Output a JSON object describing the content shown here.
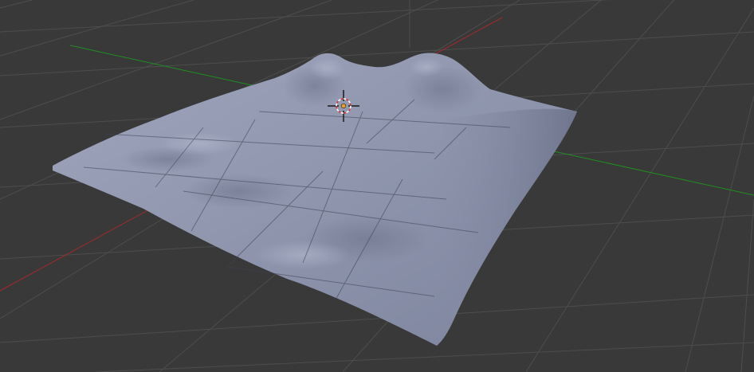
{
  "viewport": {
    "mode": "3D View",
    "background_color": "#393939",
    "grid_color": "#4d4d4d",
    "grid_visible": true
  },
  "axes": {
    "x_axis_color": "#a12a2a",
    "y_axis_color": "#1f8f1f",
    "z_axis_color": "#4a4a4a"
  },
  "object": {
    "type": "terrain-mesh",
    "shading": "smooth",
    "base_color": "#8e95ad",
    "shadow_color": "#6a7088",
    "highlight_color": "#aab1c6"
  },
  "cursor": {
    "icon": "3d-cursor-icon",
    "ring_colors": [
      "#ffffff",
      "#e03030"
    ],
    "center_color": "#f0a020"
  }
}
